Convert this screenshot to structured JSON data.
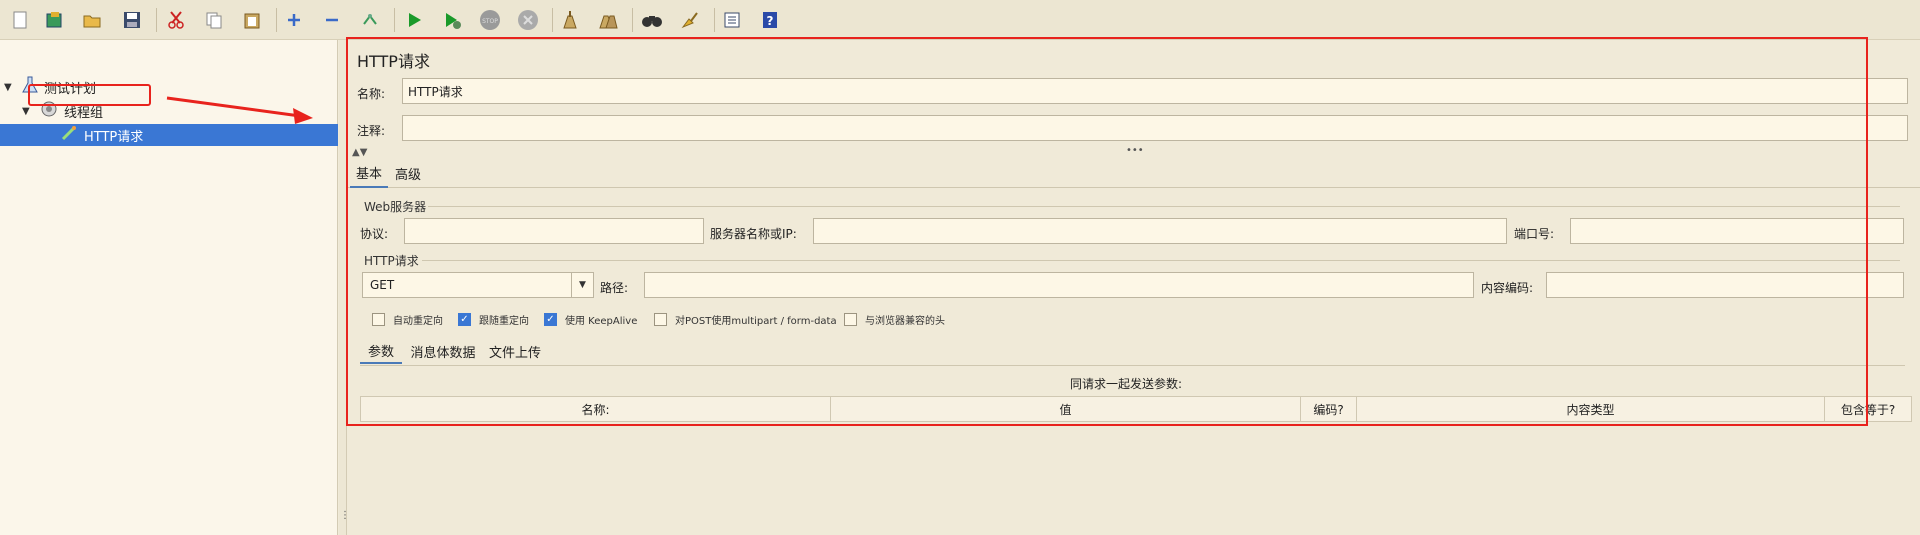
{
  "toolbar": {
    "icons": [
      "new-icon",
      "templates-icon",
      "open-icon",
      "save-icon",
      "cut-icon",
      "copy-icon",
      "paste-icon",
      "expand-icon",
      "collapse-icon",
      "toggle-icon",
      "start-icon",
      "start-no-pause-icon",
      "stop-icon",
      "shutdown-icon",
      "clear-icon",
      "clear-all-icon",
      "search-icon",
      "reset-search-icon",
      "function-helper-icon",
      "help-icon"
    ]
  },
  "tree": {
    "items": [
      {
        "label": "测试计划"
      },
      {
        "label": "线程组"
      },
      {
        "label": "HTTP请求"
      }
    ]
  },
  "panel": {
    "title": "HTTP请求",
    "name_label": "名称:",
    "name_value": "HTTP请求",
    "comment_label": "注释:",
    "comment_value": "",
    "tabs": [
      {
        "label": "基本"
      },
      {
        "label": "高级"
      }
    ],
    "web_server": {
      "group_title": "Web服务器",
      "protocol_label": "协议:",
      "protocol_value": "",
      "server_label": "服务器名称或IP:",
      "server_value": "",
      "port_label": "端口号:",
      "port_value": ""
    },
    "http_request": {
      "group_title": "HTTP请求",
      "method_value": "GET",
      "path_label": "路径:",
      "path_value": "",
      "encoding_label": "内容编码:",
      "encoding_value": ""
    },
    "checkboxes": [
      {
        "label": "自动重定向",
        "checked": false
      },
      {
        "label": "跟随重定向",
        "checked": true
      },
      {
        "label": "使用 KeepAlive",
        "checked": true
      },
      {
        "label": "对POST使用multipart / form-data",
        "checked": false
      },
      {
        "label": "与浏览器兼容的头",
        "checked": false
      }
    ],
    "sub_tabs": [
      {
        "label": "参数"
      },
      {
        "label": "消息体数据"
      },
      {
        "label": "文件上传"
      }
    ],
    "params_caption": "同请求一起发送参数:",
    "columns": [
      "名称:",
      "值",
      "编码?",
      "内容类型",
      "包含等于?"
    ]
  },
  "colors": {
    "background": "#f0ead8",
    "selection": "#3a77d4",
    "annotation": "#e8231d"
  }
}
